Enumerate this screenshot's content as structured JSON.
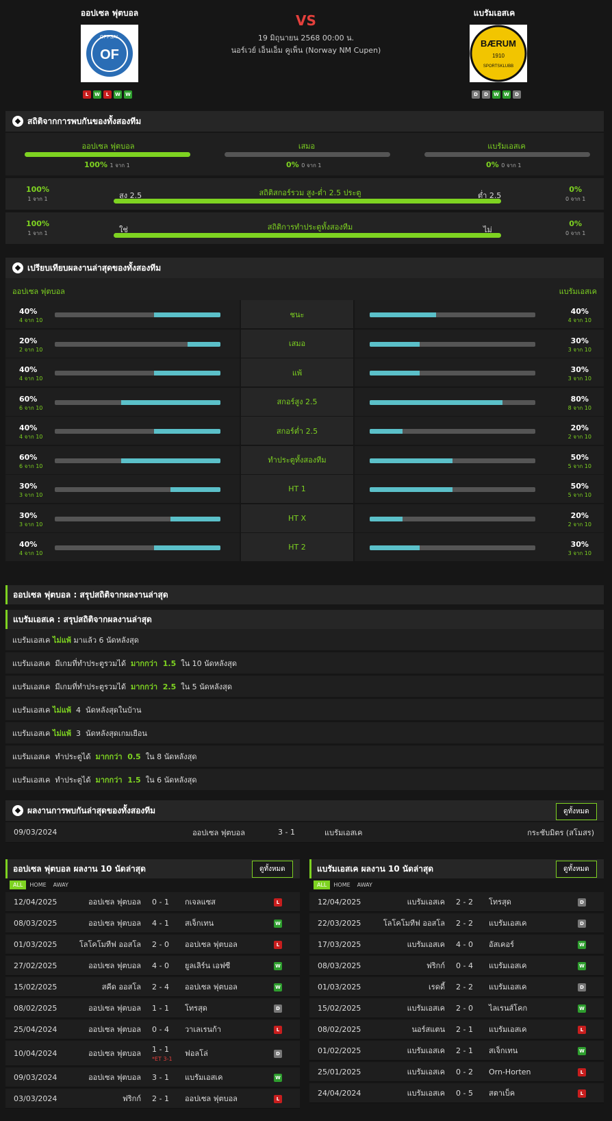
{
  "match": {
    "home": "ออปเซล ฟุตบอล",
    "away": "แบรัมเอสเค",
    "vs": "VS",
    "date": "19 มิถุนายน 2568 00:00 น.",
    "competition": "นอร์เวย์ เอ็นเอ็ม คูเพ็น (Norway NM Cupen)",
    "home_form": [
      "L",
      "W",
      "L",
      "W",
      "W"
    ],
    "away_form": [
      "D",
      "D",
      "W",
      "W",
      "D"
    ],
    "home_logo_text": "OPPSAL IF",
    "away_logo_text": "BÆRUM"
  },
  "h2h": {
    "title": "สถิติจากการพบกันของทั้งสองทีม",
    "home_label": "ออปเซล ฟุตบอล",
    "draw_label": "เสมอ",
    "away_label": "แบรัมเอสเค",
    "home_pct": "100%",
    "home_sub": "1 จาก 1",
    "draw_pct": "0%",
    "draw_sub": "0 จาก 1",
    "away_pct": "0%",
    "away_sub": "0 จาก 1",
    "home_fill": 1,
    "draw_fill": 0,
    "away_fill": 0
  },
  "ou": {
    "title": "สถิติสกอร์รวม สูง-ต่ำ 2.5 ประตู",
    "left_label": "สูง 2.5",
    "right_label": "ต่ำ 2.5",
    "left_pct": "100%",
    "left_sub": "1 จาก 1",
    "right_pct": "0%",
    "right_sub": "0 จาก 1",
    "fill": 1
  },
  "btts": {
    "title": "สถิติการทำประตูทั้งสองทีม",
    "left_label": "ใช่",
    "right_label": "ไม่",
    "left_pct": "100%",
    "left_sub": "1 จาก 1",
    "right_pct": "0%",
    "right_sub": "0 จาก 1",
    "fill": 1
  },
  "compare": {
    "title": "เปรียบเทียบผลงานล่าสุดของทั้งสองทีม",
    "home": "ออปเซล ฟุตบอล",
    "away": "แบรัมเอสเค",
    "rows": [
      {
        "label": "ชนะ",
        "hp": "40%",
        "hs": "4 จาก 10",
        "hv": 0.4,
        "ap": "40%",
        "as": "4 จาก 10",
        "av": 0.4
      },
      {
        "label": "เสมอ",
        "hp": "20%",
        "hs": "2 จาก 10",
        "hv": 0.2,
        "ap": "30%",
        "as": "3 จาก 10",
        "av": 0.3
      },
      {
        "label": "แพ้",
        "hp": "40%",
        "hs": "4 จาก 10",
        "hv": 0.4,
        "ap": "30%",
        "as": "3 จาก 10",
        "av": 0.3
      },
      {
        "label": "สกอร์สูง 2.5",
        "hp": "60%",
        "hs": "6 จาก 10",
        "hv": 0.6,
        "ap": "80%",
        "as": "8 จาก 10",
        "av": 0.8
      },
      {
        "label": "สกอร์ต่ำ 2.5",
        "hp": "40%",
        "hs": "4 จาก 10",
        "hv": 0.4,
        "ap": "20%",
        "as": "2 จาก 10",
        "av": 0.2
      },
      {
        "label": "ทำประตูทั้งสองทีม",
        "hp": "60%",
        "hs": "6 จาก 10",
        "hv": 0.6,
        "ap": "50%",
        "as": "5 จาก 10",
        "av": 0.5
      },
      {
        "label": "HT 1",
        "hp": "30%",
        "hs": "3 จาก 10",
        "hv": 0.3,
        "ap": "50%",
        "as": "5 จาก 10",
        "av": 0.5
      },
      {
        "label": "HT X",
        "hp": "30%",
        "hs": "3 จาก 10",
        "hv": 0.3,
        "ap": "20%",
        "as": "2 จาก 10",
        "av": 0.2
      },
      {
        "label": "HT 2",
        "hp": "40%",
        "hs": "4 จาก 10",
        "hv": 0.4,
        "ap": "30%",
        "as": "3 จาก 10",
        "av": 0.3
      }
    ]
  },
  "summary": {
    "home_title": "ออปเซล ฟุตบอล : สรุปสถิติจากผลงานล่าสุด",
    "away_title": "แบรัมเอสเค : สรุปสถิติจากผลงานล่าสุด",
    "items": [
      [
        {
          "t": "แบรัมเอสเค "
        },
        {
          "t": "ไม่แพ้",
          "g": 1
        },
        {
          "t": " มาแล้ว 6 นัดหลังสุด"
        }
      ],
      [
        {
          "t": "แบรัมเอสเค  มีเกมที่ทำประตูรวมได้  "
        },
        {
          "t": "มากกว่า  1.5",
          "g": 1
        },
        {
          "t": "  ใน 10 นัดหลังสุด"
        }
      ],
      [
        {
          "t": "แบรัมเอสเค  มีเกมที่ทำประตูรวมได้  "
        },
        {
          "t": "มากกว่า  2.5",
          "g": 1
        },
        {
          "t": "  ใน 5 นัดหลังสุด"
        }
      ],
      [
        {
          "t": "แบรัมเอสเค "
        },
        {
          "t": "ไม่แพ้",
          "g": 1
        },
        {
          "t": "  4  นัดหลังสุดในบ้าน"
        }
      ],
      [
        {
          "t": "แบรัมเอสเค "
        },
        {
          "t": "ไม่แพ้",
          "g": 1
        },
        {
          "t": "  3  นัดหลังสุดเกมเยือน"
        }
      ],
      [
        {
          "t": "แบรัมเอสเค  ทำประตูได้  "
        },
        {
          "t": "มากกว่า  0.5",
          "g": 1
        },
        {
          "t": "  ใน 8 นัดหลังสุด"
        }
      ],
      [
        {
          "t": "แบรัมเอสเค  ทำประตูได้  "
        },
        {
          "t": "มากกว่า  1.5",
          "g": 1
        },
        {
          "t": "  ใน 6 นัดหลังสุด"
        }
      ]
    ]
  },
  "recent_h2h": {
    "title": "ผลงานการพบกันล่าสุดของทั้งสองทีม",
    "view_all": "ดูทั้งหมด",
    "date": "09/03/2024",
    "home": "ออปเซล ฟุตบอล",
    "score": "3 - 1",
    "away": "แบรัมเอสเค",
    "comp": "กระชับมิตร (สโมสร)"
  },
  "tabs": [
    "ALL",
    "HOME",
    "AWAY"
  ],
  "home_last": {
    "title": "ออปเซล ฟุตบอล ผลงาน 10 นัดล่าสุด",
    "view_all": "ดูทั้งหมด",
    "rows": [
      {
        "d": "12/04/2025",
        "h": "ออปเซล ฟุตบอล",
        "s": "0 - 1",
        "a": "กเจลแซส",
        "r": "L"
      },
      {
        "d": "08/03/2025",
        "h": "ออปเซล ฟุตบอล",
        "s": "4 - 1",
        "a": "สเจ็กเทน",
        "r": "W"
      },
      {
        "d": "01/03/2025",
        "h": "โลโคโมทีฟ ออสโล",
        "s": "2 - 0",
        "a": "ออปเซล ฟุตบอล",
        "r": "L"
      },
      {
        "d": "27/02/2025",
        "h": "ออปเซล ฟุตบอล",
        "s": "4 - 0",
        "a": "ยูลเลิร์น เอฟซี",
        "r": "W"
      },
      {
        "d": "15/02/2025",
        "h": "สคีด ออสโล",
        "s": "2 - 4",
        "a": "ออปเซล ฟุตบอล",
        "r": "W"
      },
      {
        "d": "08/02/2025",
        "h": "ออปเซล ฟุตบอล",
        "s": "1 - 1",
        "a": "โทรสุด",
        "r": "D"
      },
      {
        "d": "25/04/2024",
        "h": "ออปเซล ฟุตบอล",
        "s": "0 - 4",
        "a": "วาเลเรนก้า",
        "r": "L"
      },
      {
        "d": "10/04/2024",
        "h": "ออปเซล ฟุตบอล",
        "s": "1 - 1",
        "a": "ฟอลโล่",
        "r": "D",
        "et": "*ET 3-1"
      },
      {
        "d": "09/03/2024",
        "h": "ออปเซล ฟุตบอล",
        "s": "3 - 1",
        "a": "แบรัมเอสเค",
        "r": "W"
      },
      {
        "d": "03/03/2024",
        "h": "ฟริกก์",
        "s": "2 - 1",
        "a": "ออปเซล ฟุตบอล",
        "r": "L"
      }
    ]
  },
  "away_last": {
    "title": "แบรัมเอสเค ผลงาน 10 นัดล่าสุด",
    "view_all": "ดูทั้งหมด",
    "rows": [
      {
        "d": "12/04/2025",
        "h": "แบรัมเอสเค",
        "s": "2 - 2",
        "a": "โทรสุด",
        "r": "D"
      },
      {
        "d": "22/03/2025",
        "h": "โลโคโมทีฟ ออสโล",
        "s": "2 - 2",
        "a": "แบรัมเอสเค",
        "r": "D"
      },
      {
        "d": "17/03/2025",
        "h": "แบรัมเอสเค",
        "s": "4 - 0",
        "a": "อัสเคอร์",
        "r": "W"
      },
      {
        "d": "08/03/2025",
        "h": "ฟริกก์",
        "s": "0 - 4",
        "a": "แบรัมเอสเค",
        "r": "W"
      },
      {
        "d": "01/03/2025",
        "h": "เรดดี้",
        "s": "2 - 2",
        "a": "แบรัมเอสเค",
        "r": "D"
      },
      {
        "d": "15/02/2025",
        "h": "แบรัมเอสเค",
        "s": "2 - 0",
        "a": "ไลเรนส์โคก",
        "r": "W"
      },
      {
        "d": "08/02/2025",
        "h": "นอร์สแตน",
        "s": "2 - 1",
        "a": "แบรัมเอสเค",
        "r": "L"
      },
      {
        "d": "01/02/2025",
        "h": "แบรัมเอสเค",
        "s": "2 - 1",
        "a": "สเจ็กเทน",
        "r": "W"
      },
      {
        "d": "25/01/2025",
        "h": "แบรัมเอสเค",
        "s": "0 - 2",
        "a": "Orn-Horten",
        "r": "L"
      },
      {
        "d": "24/04/2024",
        "h": "แบรัมเอสเค",
        "s": "0 - 5",
        "a": "สตาเบ็ค",
        "r": "L"
      }
    ]
  }
}
